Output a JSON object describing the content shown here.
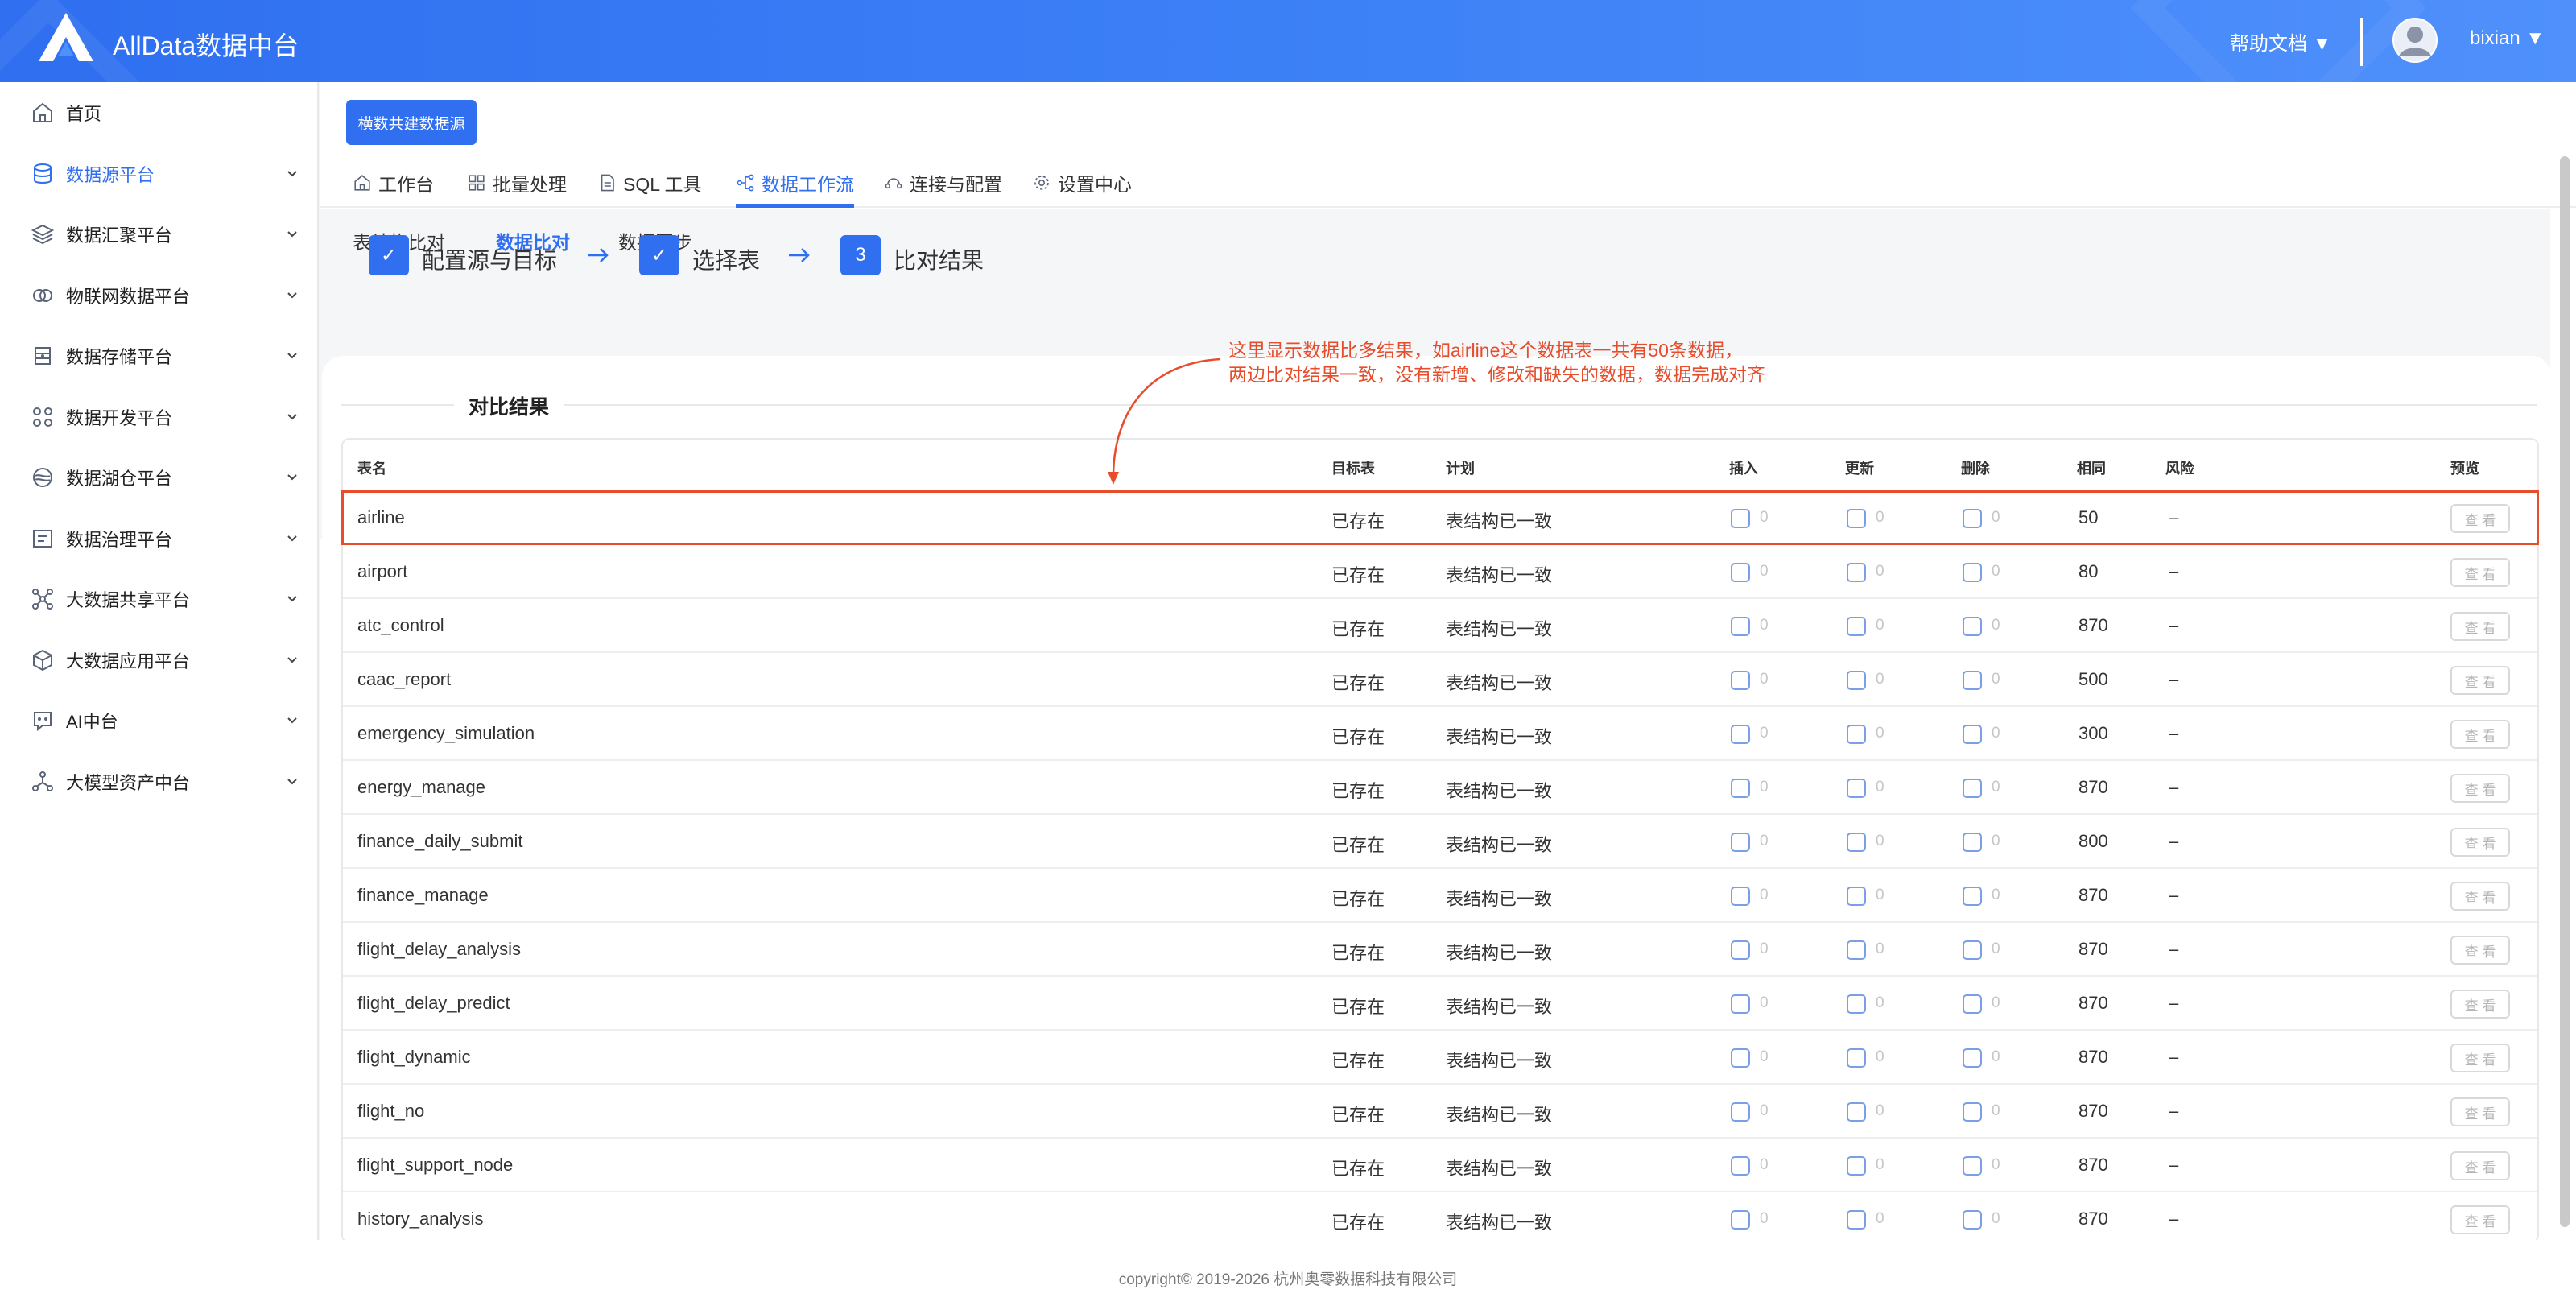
{
  "header": {
    "app_title": "AllData数据中台",
    "help": "帮助文档 ▼",
    "username": "bixian ▼"
  },
  "sidebar": {
    "items": [
      {
        "label": "首页",
        "icon": "home-icon",
        "active": false,
        "expandable": false
      },
      {
        "label": "数据源平台",
        "icon": "database-icon",
        "active": true,
        "expandable": true
      },
      {
        "label": "数据汇聚平台",
        "icon": "layers-icon",
        "active": false,
        "expandable": true
      },
      {
        "label": "物联网数据平台",
        "icon": "iot-icon",
        "active": false,
        "expandable": true
      },
      {
        "label": "数据存储平台",
        "icon": "storage-icon",
        "active": false,
        "expandable": true
      },
      {
        "label": "数据开发平台",
        "icon": "dev-icon",
        "active": false,
        "expandable": true
      },
      {
        "label": "数据湖仓平台",
        "icon": "lake-icon",
        "active": false,
        "expandable": true
      },
      {
        "label": "数据治理平台",
        "icon": "governance-icon",
        "active": false,
        "expandable": true
      },
      {
        "label": "大数据共享平台",
        "icon": "share-icon",
        "active": false,
        "expandable": true
      },
      {
        "label": "大数据应用平台",
        "icon": "cube-icon",
        "active": false,
        "expandable": true
      },
      {
        "label": "AI中台",
        "icon": "ai-icon",
        "active": false,
        "expandable": true
      },
      {
        "label": "大模型资产中台",
        "icon": "model-icon",
        "active": false,
        "expandable": true
      }
    ]
  },
  "main": {
    "primary_button": "横数共建数据源",
    "tabs": [
      {
        "label": "工作台",
        "icon": "home-icon"
      },
      {
        "label": "批量处理",
        "icon": "grid-icon"
      },
      {
        "label": "SQL 工具",
        "icon": "file-icon"
      },
      {
        "label": "数据工作流",
        "icon": "flow-icon",
        "active": true
      },
      {
        "label": "连接与配置",
        "icon": "connect-icon"
      },
      {
        "label": "设置中心",
        "icon": "gear-icon"
      }
    ],
    "subtabs": [
      {
        "label": "表结构比对",
        "active": false
      },
      {
        "label": "数据比对",
        "active": true
      },
      {
        "label": "数据同步",
        "active": false
      }
    ],
    "steps": [
      {
        "mark": "✓",
        "label": "配置源与目标"
      },
      {
        "mark": "✓",
        "label": "选择表"
      },
      {
        "mark": "3",
        "label": "比对结果"
      }
    ],
    "section_title": "对比结果",
    "annotation": {
      "line1": "这里显示数据比多结果，如airline这个数据表一共有50条数据，",
      "line2": "两边比对结果一致，没有新增、修改和缺失的数据，数据完成对齐"
    },
    "table": {
      "columns": [
        "表名",
        "目标表",
        "计划",
        "插入",
        "更新",
        "删除",
        "相同",
        "风险",
        "预览"
      ],
      "rows": [
        {
          "name": "airline",
          "target": "已存在",
          "plan": "表结构已一致",
          "insert": "0",
          "update": "0",
          "delete": "0",
          "same": "50",
          "risk": "–",
          "view": "查 看"
        },
        {
          "name": "airport",
          "target": "已存在",
          "plan": "表结构已一致",
          "insert": "0",
          "update": "0",
          "delete": "0",
          "same": "80",
          "risk": "–",
          "view": "查 看"
        },
        {
          "name": "atc_control",
          "target": "已存在",
          "plan": "表结构已一致",
          "insert": "0",
          "update": "0",
          "delete": "0",
          "same": "870",
          "risk": "–",
          "view": "查 看"
        },
        {
          "name": "caac_report",
          "target": "已存在",
          "plan": "表结构已一致",
          "insert": "0",
          "update": "0",
          "delete": "0",
          "same": "500",
          "risk": "–",
          "view": "查 看"
        },
        {
          "name": "emergency_simulation",
          "target": "已存在",
          "plan": "表结构已一致",
          "insert": "0",
          "update": "0",
          "delete": "0",
          "same": "300",
          "risk": "–",
          "view": "查 看"
        },
        {
          "name": "energy_manage",
          "target": "已存在",
          "plan": "表结构已一致",
          "insert": "0",
          "update": "0",
          "delete": "0",
          "same": "870",
          "risk": "–",
          "view": "查 看"
        },
        {
          "name": "finance_daily_submit",
          "target": "已存在",
          "plan": "表结构已一致",
          "insert": "0",
          "update": "0",
          "delete": "0",
          "same": "800",
          "risk": "–",
          "view": "查 看"
        },
        {
          "name": "finance_manage",
          "target": "已存在",
          "plan": "表结构已一致",
          "insert": "0",
          "update": "0",
          "delete": "0",
          "same": "870",
          "risk": "–",
          "view": "查 看"
        },
        {
          "name": "flight_delay_analysis",
          "target": "已存在",
          "plan": "表结构已一致",
          "insert": "0",
          "update": "0",
          "delete": "0",
          "same": "870",
          "risk": "–",
          "view": "查 看"
        },
        {
          "name": "flight_delay_predict",
          "target": "已存在",
          "plan": "表结构已一致",
          "insert": "0",
          "update": "0",
          "delete": "0",
          "same": "870",
          "risk": "–",
          "view": "查 看"
        },
        {
          "name": "flight_dynamic",
          "target": "已存在",
          "plan": "表结构已一致",
          "insert": "0",
          "update": "0",
          "delete": "0",
          "same": "870",
          "risk": "–",
          "view": "查 看"
        },
        {
          "name": "flight_no",
          "target": "已存在",
          "plan": "表结构已一致",
          "insert": "0",
          "update": "0",
          "delete": "0",
          "same": "870",
          "risk": "–",
          "view": "查 看"
        },
        {
          "name": "flight_support_node",
          "target": "已存在",
          "plan": "表结构已一致",
          "insert": "0",
          "update": "0",
          "delete": "0",
          "same": "870",
          "risk": "–",
          "view": "查 看"
        },
        {
          "name": "history_analysis",
          "target": "已存在",
          "plan": "表结构已一致",
          "insert": "0",
          "update": "0",
          "delete": "0",
          "same": "870",
          "risk": "–",
          "view": "查 看"
        }
      ]
    }
  },
  "footer": {
    "text": "copyright© 2019-2026 杭州奥零数据科技有限公司"
  },
  "colors": {
    "primary": "#2f6ff0",
    "annotation": "#e74c2b"
  }
}
